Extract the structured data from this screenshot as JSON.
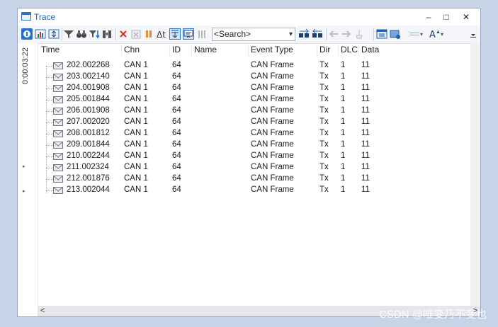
{
  "window": {
    "title": "Trace"
  },
  "window_controls": {
    "minimize": "–",
    "maximize": "□",
    "close": "✕"
  },
  "search": {
    "placeholder": "<Search>"
  },
  "sidebar": {
    "timestamp": "0:00:03:22"
  },
  "columns": [
    "Time",
    "Chn",
    "ID",
    "Name",
    "Event Type",
    "Dir",
    "DLC",
    "Data"
  ],
  "rows": [
    {
      "time": "202.002268",
      "chn": "CAN 1",
      "id": "64",
      "name": "",
      "event_type": "CAN Frame",
      "dir": "Tx",
      "dlc": "1",
      "data": "11"
    },
    {
      "time": "203.002140",
      "chn": "CAN 1",
      "id": "64",
      "name": "",
      "event_type": "CAN Frame",
      "dir": "Tx",
      "dlc": "1",
      "data": "11"
    },
    {
      "time": "204.001908",
      "chn": "CAN 1",
      "id": "64",
      "name": "",
      "event_type": "CAN Frame",
      "dir": "Tx",
      "dlc": "1",
      "data": "11"
    },
    {
      "time": "205.001844",
      "chn": "CAN 1",
      "id": "64",
      "name": "",
      "event_type": "CAN Frame",
      "dir": "Tx",
      "dlc": "1",
      "data": "11"
    },
    {
      "time": "206.001908",
      "chn": "CAN 1",
      "id": "64",
      "name": "",
      "event_type": "CAN Frame",
      "dir": "Tx",
      "dlc": "1",
      "data": "11"
    },
    {
      "time": "207.002020",
      "chn": "CAN 1",
      "id": "64",
      "name": "",
      "event_type": "CAN Frame",
      "dir": "Tx",
      "dlc": "1",
      "data": "11"
    },
    {
      "time": "208.001812",
      "chn": "CAN 1",
      "id": "64",
      "name": "",
      "event_type": "CAN Frame",
      "dir": "Tx",
      "dlc": "1",
      "data": "11"
    },
    {
      "time": "209.001844",
      "chn": "CAN 1",
      "id": "64",
      "name": "",
      "event_type": "CAN Frame",
      "dir": "Tx",
      "dlc": "1",
      "data": "11"
    },
    {
      "time": "210.002244",
      "chn": "CAN 1",
      "id": "64",
      "name": "",
      "event_type": "CAN Frame",
      "dir": "Tx",
      "dlc": "1",
      "data": "11"
    },
    {
      "time": "211.002324",
      "chn": "CAN 1",
      "id": "64",
      "name": "",
      "event_type": "CAN Frame",
      "dir": "Tx",
      "dlc": "1",
      "data": "11"
    },
    {
      "time": "212.001876",
      "chn": "CAN 1",
      "id": "64",
      "name": "",
      "event_type": "CAN Frame",
      "dir": "Tx",
      "dlc": "1",
      "data": "11"
    },
    {
      "time": "213.002044",
      "chn": "CAN 1",
      "id": "64",
      "name": "",
      "event_type": "CAN Frame",
      "dir": "Tx",
      "dlc": "1",
      "data": "11"
    }
  ],
  "watermark": "CSDN @唯变乃不变也",
  "colors": {
    "accent": "#1f5fae",
    "delete": "#d93025",
    "pause": "#f28c28"
  },
  "toolbar_icons": [
    "statistics-icon",
    "chart-icon",
    "expand-icon",
    "filter-icon",
    "binoculars-icon",
    "filter-down-icon",
    "find-icon",
    "delete-icon",
    "clear-icon",
    "pause-icon",
    "delta-time-icon",
    "scroll-down-icon",
    "chronological-icon",
    "columns-icon",
    "search-dropdown-icon",
    "find-next-icon",
    "find-prev-icon",
    "back-icon",
    "forward-icon",
    "mark-icon",
    "window-icon",
    "export-icon",
    "separator-icon",
    "font-icon",
    "overflow-icon"
  ]
}
